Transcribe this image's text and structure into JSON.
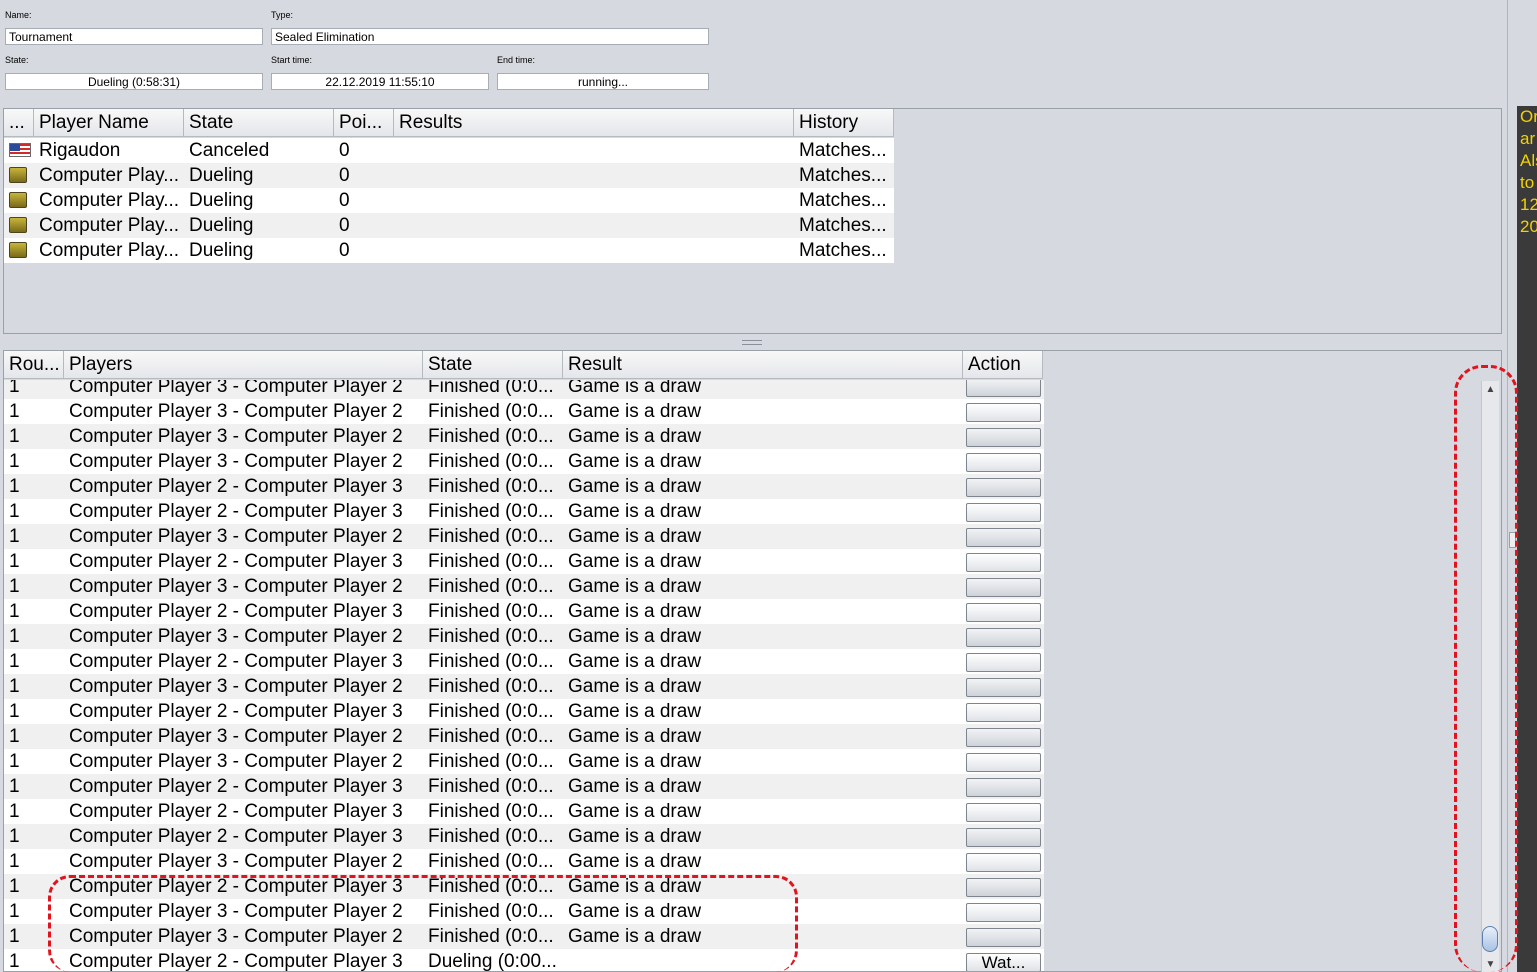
{
  "info": {
    "name_label": "Name:",
    "name_value": "Tournament",
    "type_label": "Type:",
    "type_value": "Sealed Elimination",
    "state_label": "State:",
    "state_value": "Dueling (0:58:31)",
    "start_label": "Start time:",
    "start_value": "22.12.2019 11:55:10",
    "end_label": "End time:",
    "end_value": "running..."
  },
  "players": {
    "headers": [
      "...",
      "Player Name",
      "State",
      "Poi...",
      "Results",
      "History"
    ],
    "rows": [
      {
        "flag": "us-flag-icon",
        "name": "Rigaudon",
        "state": "Canceled",
        "points": "0",
        "results": "",
        "history": "Matches..."
      },
      {
        "flag": "computer-player-icon",
        "name": "Computer Play...",
        "state": "Dueling",
        "points": "0",
        "results": "",
        "history": "Matches..."
      },
      {
        "flag": "computer-player-icon",
        "name": "Computer Play...",
        "state": "Dueling",
        "points": "0",
        "results": "",
        "history": "Matches..."
      },
      {
        "flag": "computer-player-icon",
        "name": "Computer Play...",
        "state": "Dueling",
        "points": "0",
        "results": "",
        "history": "Matches..."
      },
      {
        "flag": "computer-player-icon",
        "name": "Computer Play...",
        "state": "Dueling",
        "points": "0",
        "results": "",
        "history": "Matches..."
      }
    ]
  },
  "matches": {
    "headers": [
      "Rou...",
      "Players",
      "State",
      "Result",
      "Action"
    ],
    "rows": [
      {
        "round": "1",
        "players": "Computer Player 3 - Computer Player 2",
        "state": "Finished (0:0...",
        "result": "Game is a draw",
        "action": ""
      },
      {
        "round": "1",
        "players": "Computer Player 3 - Computer Player 2",
        "state": "Finished (0:0...",
        "result": "Game is a draw",
        "action": ""
      },
      {
        "round": "1",
        "players": "Computer Player 3 - Computer Player 2",
        "state": "Finished (0:0...",
        "result": "Game is a draw",
        "action": ""
      },
      {
        "round": "1",
        "players": "Computer Player 3 - Computer Player 2",
        "state": "Finished (0:0...",
        "result": "Game is a draw",
        "action": ""
      },
      {
        "round": "1",
        "players": "Computer Player 2 - Computer Player 3",
        "state": "Finished (0:0...",
        "result": "Game is a draw",
        "action": ""
      },
      {
        "round": "1",
        "players": "Computer Player 2 - Computer Player 3",
        "state": "Finished (0:0...",
        "result": "Game is a draw",
        "action": ""
      },
      {
        "round": "1",
        "players": "Computer Player 3 - Computer Player 2",
        "state": "Finished (0:0...",
        "result": "Game is a draw",
        "action": ""
      },
      {
        "round": "1",
        "players": "Computer Player 2 - Computer Player 3",
        "state": "Finished (0:0...",
        "result": "Game is a draw",
        "action": ""
      },
      {
        "round": "1",
        "players": "Computer Player 3 - Computer Player 2",
        "state": "Finished (0:0...",
        "result": "Game is a draw",
        "action": ""
      },
      {
        "round": "1",
        "players": "Computer Player 2 - Computer Player 3",
        "state": "Finished (0:0...",
        "result": "Game is a draw",
        "action": ""
      },
      {
        "round": "1",
        "players": "Computer Player 3 - Computer Player 2",
        "state": "Finished (0:0...",
        "result": "Game is a draw",
        "action": ""
      },
      {
        "round": "1",
        "players": "Computer Player 2 - Computer Player 3",
        "state": "Finished (0:0...",
        "result": "Game is a draw",
        "action": ""
      },
      {
        "round": "1",
        "players": "Computer Player 3 - Computer Player 2",
        "state": "Finished (0:0...",
        "result": "Game is a draw",
        "action": ""
      },
      {
        "round": "1",
        "players": "Computer Player 2 - Computer Player 3",
        "state": "Finished (0:0...",
        "result": "Game is a draw",
        "action": ""
      },
      {
        "round": "1",
        "players": "Computer Player 3 - Computer Player 2",
        "state": "Finished (0:0...",
        "result": "Game is a draw",
        "action": ""
      },
      {
        "round": "1",
        "players": "Computer Player 3 - Computer Player 2",
        "state": "Finished (0:0...",
        "result": "Game is a draw",
        "action": ""
      },
      {
        "round": "1",
        "players": "Computer Player 2 - Computer Player 3",
        "state": "Finished (0:0...",
        "result": "Game is a draw",
        "action": ""
      },
      {
        "round": "1",
        "players": "Computer Player 2 - Computer Player 3",
        "state": "Finished (0:0...",
        "result": "Game is a draw",
        "action": ""
      },
      {
        "round": "1",
        "players": "Computer Player 2 - Computer Player 3",
        "state": "Finished (0:0...",
        "result": "Game is a draw",
        "action": ""
      },
      {
        "round": "1",
        "players": "Computer Player 3 - Computer Player 2",
        "state": "Finished (0:0...",
        "result": "Game is a draw",
        "action": ""
      },
      {
        "round": "1",
        "players": "Computer Player 2 - Computer Player 3",
        "state": "Finished (0:0...",
        "result": "Game is a draw",
        "action": ""
      },
      {
        "round": "1",
        "players": "Computer Player 3 - Computer Player 2",
        "state": "Finished (0:0...",
        "result": "Game is a draw",
        "action": ""
      },
      {
        "round": "1",
        "players": "Computer Player 3 - Computer Player 2",
        "state": "Finished (0:0...",
        "result": "Game is a draw",
        "action": ""
      },
      {
        "round": "1",
        "players": "Computer Player 2 - Computer Player 3",
        "state": "Dueling (0:00...",
        "result": "",
        "action": "Wat..."
      }
    ]
  },
  "chat": {
    "lines": [
      "Or",
      "ar",
      "Als",
      "to",
      "12",
      "20"
    ]
  },
  "colors": {
    "background": "#d6d9df",
    "row_alt": "#f0f0f0",
    "chat_background": "#3a3a3a",
    "chat_text": "#f2d200",
    "annotation": "#e0141e"
  },
  "scroll": {
    "position": 1.0
  }
}
